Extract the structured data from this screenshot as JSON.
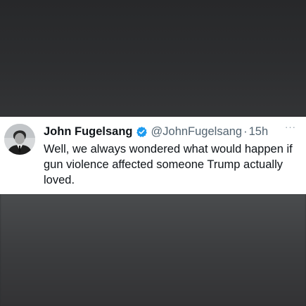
{
  "tweet": {
    "author_name": "John Fugelsang",
    "handle": "@JohnFugelsang",
    "separator": "·",
    "time": "15h",
    "more": "···",
    "text": "Well, we always wondered what would happen if gun violence affected someone Trump actually loved."
  },
  "icons": {
    "verified": "verified-badge-icon",
    "more": "more-options-icon"
  },
  "colors": {
    "verified_blue": "#1d9bf0",
    "secondary_text": "#536471",
    "primary_text": "#0f1419"
  }
}
